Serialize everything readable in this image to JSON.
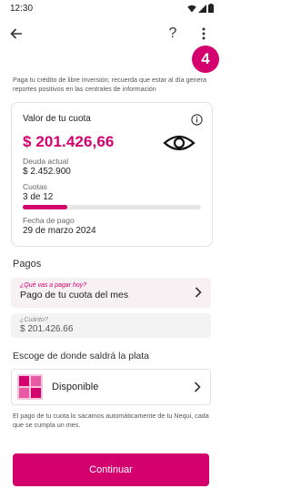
{
  "status_bar": {
    "time": "12:30"
  },
  "app_bar": {
    "help_label": "?",
    "step_number": "4"
  },
  "intro_text": "Paga tu crédito de libre inversión; recuerda que estar al día genera reportes positivos en las centrales de información",
  "card": {
    "title": "Valor de tu cuota",
    "amount": "$ 201.426,66",
    "debt_label": "Deuda actual",
    "debt_value": "$ 2.452.900",
    "installments_label": "Cuotas",
    "installments_value": "3 de 12",
    "installments_progress": 0.25,
    "due_label": "Fecha de pago",
    "due_value": "29 de marzo 2024"
  },
  "payments": {
    "title": "Pagos",
    "select_hint": "¿Qué vas a pagar hoy?",
    "select_value": "Pago de tu cuota del mes",
    "amount_hint": "¿Cuánto?",
    "amount_value": "$ 201.426.66"
  },
  "source": {
    "title": "Escoge de donde saldrá la plata",
    "option_label": "Disponible"
  },
  "footer_note": "El pago de tu cuota lo sacamos automáticamente de tu Nequi, cada que se cumpla un mes.",
  "cta_label": "Continuar",
  "colors": {
    "accent": "#d4006d"
  }
}
